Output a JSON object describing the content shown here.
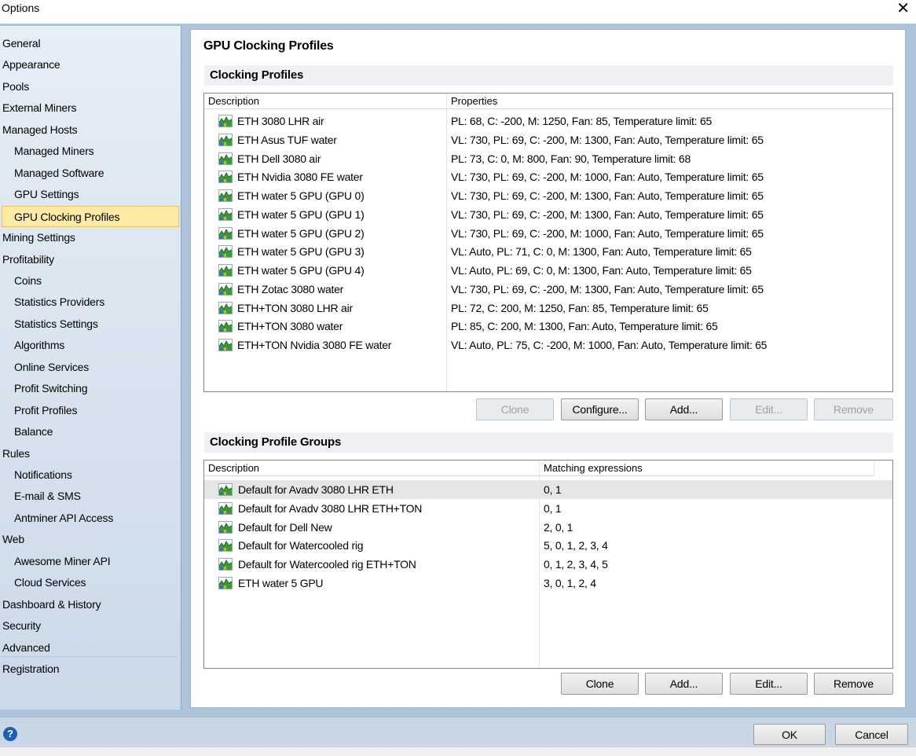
{
  "window": {
    "title": "Options",
    "close_glyph": "✕"
  },
  "sidebar": {
    "items": [
      {
        "label": "General",
        "level": 0
      },
      {
        "label": "Appearance",
        "level": 0
      },
      {
        "label": "Pools",
        "level": 0
      },
      {
        "label": "External Miners",
        "level": 0
      },
      {
        "label": "Managed Hosts",
        "level": 0
      },
      {
        "label": "Managed Miners",
        "level": 1
      },
      {
        "label": "Managed Software",
        "level": 1
      },
      {
        "label": "GPU Settings",
        "level": 1
      },
      {
        "label": "GPU Clocking Profiles",
        "level": 1,
        "selected": true
      },
      {
        "label": "Mining Settings",
        "level": 0
      },
      {
        "label": "Profitability",
        "level": 0
      },
      {
        "label": "Coins",
        "level": 1
      },
      {
        "label": "Statistics Providers",
        "level": 1
      },
      {
        "label": "Statistics Settings",
        "level": 1
      },
      {
        "label": "Algorithms",
        "level": 1
      },
      {
        "label": "Online Services",
        "level": 1
      },
      {
        "label": "Profit Switching",
        "level": 1
      },
      {
        "label": "Profit Profiles",
        "level": 1
      },
      {
        "label": "Balance",
        "level": 1
      },
      {
        "label": "Rules",
        "level": 0
      },
      {
        "label": "Notifications",
        "level": 1
      },
      {
        "label": "E-mail & SMS",
        "level": 1
      },
      {
        "label": "Antminer API Access",
        "level": 1
      },
      {
        "label": "Web",
        "level": 0
      },
      {
        "label": "Awesome Miner API",
        "level": 1
      },
      {
        "label": "Cloud Services",
        "level": 1
      },
      {
        "label": "Dashboard & History",
        "level": 0
      },
      {
        "label": "Security",
        "level": 0
      },
      {
        "label": "Advanced",
        "level": 0
      },
      {
        "label": "Registration",
        "level": 0
      }
    ]
  },
  "main": {
    "title": "GPU Clocking Profiles",
    "profiles": {
      "section_title": "Clocking Profiles",
      "columns": [
        "Description",
        "Properties"
      ],
      "rows": [
        {
          "description": "ETH 3080 LHR air",
          "properties": "PL: 68, C: -200, M: 1250, Fan: 85, Temperature limit: 65"
        },
        {
          "description": "ETH Asus TUF water",
          "properties": "VL: 730, PL: 69, C: -200, M: 1300, Fan: Auto, Temperature limit: 65"
        },
        {
          "description": "ETH Dell 3080 air",
          "properties": "PL: 73, C: 0, M: 800, Fan: 90, Temperature limit: 68"
        },
        {
          "description": "ETH Nvidia 3080 FE water",
          "properties": "VL: 730, PL: 69, C: -200, M: 1000, Fan: Auto, Temperature limit: 65"
        },
        {
          "description": "ETH water 5 GPU (GPU 0)",
          "properties": "VL: 730, PL: 69, C: -200, M: 1300, Fan: Auto, Temperature limit: 65"
        },
        {
          "description": "ETH water 5 GPU (GPU 1)",
          "properties": "VL: 730, PL: 69, C: -200, M: 1300, Fan: Auto, Temperature limit: 65"
        },
        {
          "description": "ETH water 5 GPU (GPU 2)",
          "properties": "VL: 730, PL: 69, C: -200, M: 1000, Fan: Auto, Temperature limit: 65"
        },
        {
          "description": "ETH water 5 GPU (GPU 3)",
          "properties": "VL: Auto, PL: 71, C: 0, M: 1300, Fan: Auto, Temperature limit: 65"
        },
        {
          "description": "ETH water 5 GPU (GPU 4)",
          "properties": "VL: Auto, PL: 69, C: 0, M: 1300, Fan: Auto, Temperature limit: 65"
        },
        {
          "description": "ETH Zotac 3080 water",
          "properties": "VL: 730, PL: 69, C: -200, M: 1300, Fan: Auto, Temperature limit: 65"
        },
        {
          "description": "ETH+TON 3080 LHR air",
          "properties": "PL: 72, C: 200, M: 1250, Fan: 85, Temperature limit: 65"
        },
        {
          "description": "ETH+TON 3080 water",
          "properties": "PL: 85, C: 200, M: 1300, Fan: Auto, Temperature limit: 65"
        },
        {
          "description": "ETH+TON Nvidia 3080 FE water",
          "properties": "VL: Auto, PL: 75, C: -200, M: 1000, Fan: Auto, Temperature limit: 65"
        }
      ],
      "buttons": {
        "clone": "Clone",
        "configure": "Configure...",
        "add": "Add...",
        "edit": "Edit...",
        "remove": "Remove"
      }
    },
    "groups": {
      "section_title": "Clocking Profile Groups",
      "columns": [
        "Description",
        "Matching expressions"
      ],
      "rows": [
        {
          "description": "Default for Avadv 3080 LHR ETH",
          "expressions": "0, 1",
          "highlighted": true
        },
        {
          "description": "Default for Avadv 3080 LHR ETH+TON",
          "expressions": "0, 1"
        },
        {
          "description": "Default for Dell New",
          "expressions": "2, 0, 1"
        },
        {
          "description": "Default for Watercooled rig",
          "expressions": "5, 0, 1, 2, 3, 4"
        },
        {
          "description": "Default for Watercooled rig ETH+TON",
          "expressions": "0, 1, 2, 3, 4, 5"
        },
        {
          "description": "ETH water 5 GPU",
          "expressions": "3, 0, 1, 2, 4"
        }
      ],
      "buttons": {
        "clone": "Clone",
        "add": "Add...",
        "edit": "Edit...",
        "remove": "Remove"
      }
    }
  },
  "footer": {
    "help_glyph": "?",
    "ok": "OK",
    "cancel": "Cancel"
  },
  "icons": {
    "row_icon": "mountain-chart-icon",
    "help": "help-icon"
  },
  "colors": {
    "selection": "#fdeba4",
    "frame": "#adc3da",
    "help_blue": "#1c5fb6"
  }
}
